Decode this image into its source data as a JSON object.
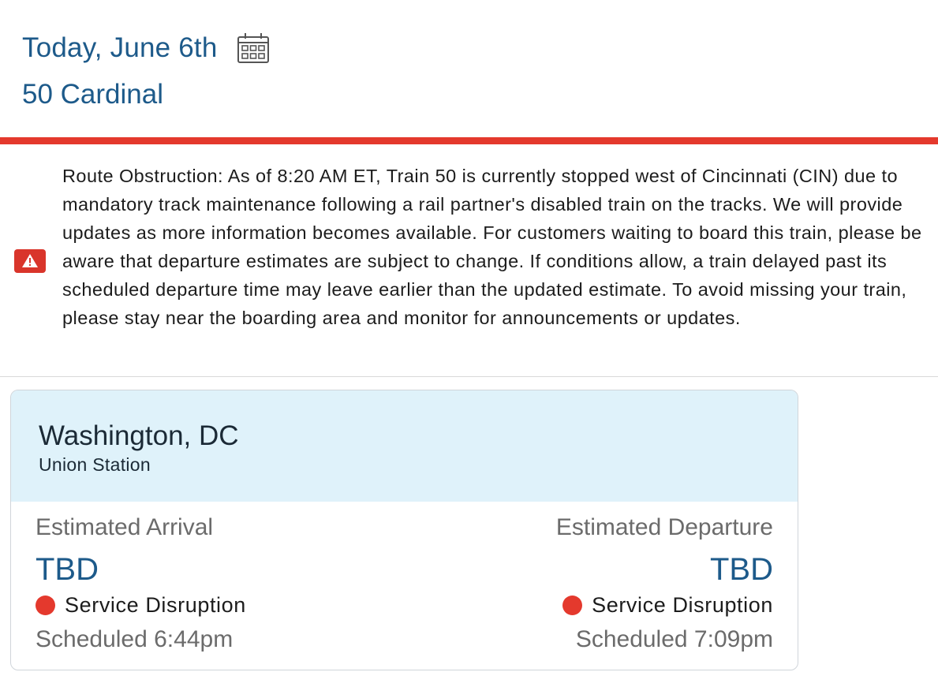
{
  "header": {
    "date": "Today, June 6th",
    "train": "50 Cardinal"
  },
  "icons": {
    "calendar": "calendar-icon",
    "alert": "warning-triangle-icon",
    "status_dot": "red-status-dot"
  },
  "colors": {
    "accent": "#1d5a8a",
    "alert_red": "#e4392d",
    "card_header_bg": "#dff2fa"
  },
  "alert": {
    "message": "Route Obstruction: As of 8:20 AM ET, Train 50 is currently stopped west of Cincinnati (CIN) due to mandatory track maintenance following a rail partner's disabled train on the tracks. We will provide updates as more information becomes available. For customers waiting to board this train, please be aware that departure estimates are subject to change. If conditions allow, a train delayed past its scheduled departure time may leave earlier than the updated estimate. To avoid missing your train, please stay near the boarding area and monitor for announcements or updates."
  },
  "station": {
    "city": "Washington, DC",
    "name": "Union Station",
    "arrival": {
      "label": "Estimated Arrival",
      "value": "TBD",
      "status": "Service Disruption",
      "scheduled": "Scheduled 6:44pm"
    },
    "departure": {
      "label": "Estimated Departure",
      "value": "TBD",
      "status": "Service Disruption",
      "scheduled": "Scheduled 7:09pm"
    }
  }
}
